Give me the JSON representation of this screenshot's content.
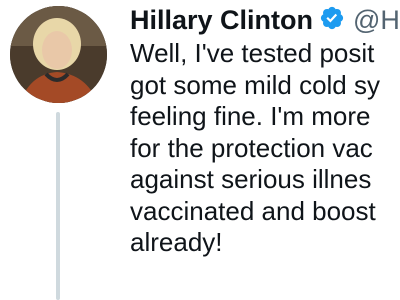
{
  "tweet": {
    "author_name": "Hillary Clinton",
    "author_handle": "@H",
    "verified": true,
    "lines": [
      "Well, I've tested posit",
      "got some mild cold sy",
      "feeling fine. I'm more",
      "for the protection vac",
      "against serious illnes",
      "vaccinated and boost",
      "already!"
    ]
  },
  "icons": {
    "verified": "verified-badge-icon"
  },
  "colors": {
    "verified": "#1d9bf0",
    "text": "#0f1419",
    "secondary": "#536471",
    "thread_line": "#cfd9de"
  }
}
